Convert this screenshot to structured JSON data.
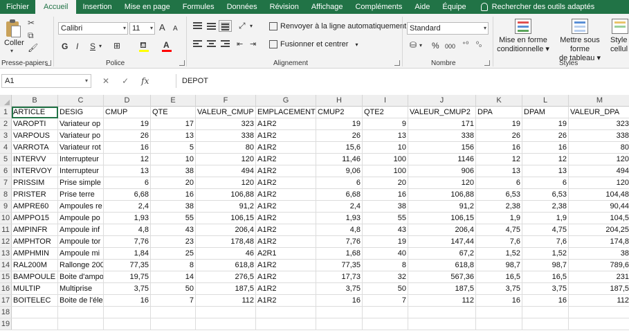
{
  "menu": {
    "tabs": [
      "Fichier",
      "Accueil",
      "Insertion",
      "Mise en page",
      "Formules",
      "Données",
      "Révision",
      "Affichage",
      "Compléments",
      "Aide",
      "Équipe"
    ],
    "active_tab": "Accueil",
    "search": "Rechercher des outils adaptés"
  },
  "ribbon": {
    "clipboard": {
      "paste": "Coller",
      "group": "Presse-papiers"
    },
    "font": {
      "name": "Calibri",
      "size": "11",
      "bold": "G",
      "italic": "I",
      "underline": "S",
      "group": "Police",
      "grow": "A",
      "shrink": "A",
      "text_color": "A",
      "fill_color": "#ffff00",
      "font_color": "#ff0000"
    },
    "alignment": {
      "wrap": "Renvoyer à la ligne automatiquement",
      "merge": "Fusionner et centrer",
      "group": "Alignement"
    },
    "number": {
      "format": "Standard",
      "percent": "%",
      "thousands": "000",
      "group": "Nombre"
    },
    "styles": {
      "conditional_1": "Mise en forme",
      "conditional_2": "conditionnelle",
      "table_1": "Mettre sous forme",
      "table_2": "de tableau",
      "cell_1": "Style",
      "cell_2": "cellul",
      "group": "Styles"
    }
  },
  "formula_bar": {
    "cell_ref": "A1",
    "fx": "fx",
    "content": "DEPOT"
  },
  "sheet": {
    "columns": [
      {
        "letter": "B"
      },
      {
        "letter": "C"
      },
      {
        "letter": "D"
      },
      {
        "letter": "E"
      },
      {
        "letter": "F"
      },
      {
        "letter": "G"
      },
      {
        "letter": "H"
      },
      {
        "letter": "I"
      },
      {
        "letter": "J"
      },
      {
        "letter": "K"
      },
      {
        "letter": "L"
      },
      {
        "letter": "M"
      }
    ],
    "row_numbers": [
      "1",
      "2",
      "3",
      "4",
      "5",
      "6",
      "7",
      "8",
      "9",
      "10",
      "11",
      "12",
      "13",
      "14",
      "15",
      "16",
      "17",
      "18",
      "19"
    ],
    "rows": [
      [
        "ARTICLE",
        "DESIG",
        "CMUP",
        "QTE",
        "VALEUR_CMUP",
        "EMPLACEMENT",
        "CMUP2",
        "QTE2",
        "VALEUR_CMUP2",
        "DPA",
        "DPAM",
        "VALEUR_DPA"
      ],
      [
        "VAROPTI",
        "Variateur op",
        "19",
        "17",
        "323",
        "A1R2",
        "19",
        "9",
        "171",
        "19",
        "19",
        "323"
      ],
      [
        "VARPOUS",
        "Variateur po",
        "26",
        "13",
        "338",
        "A1R2",
        "26",
        "13",
        "338",
        "26",
        "26",
        "338"
      ],
      [
        "VARROTA",
        "Variateur rot",
        "16",
        "5",
        "80",
        "A1R2",
        "15,6",
        "10",
        "156",
        "16",
        "16",
        "80"
      ],
      [
        "INTERVV",
        "Interrupteur",
        "12",
        "10",
        "120",
        "A1R2",
        "11,46",
        "100",
        "1146",
        "12",
        "12",
        "120"
      ],
      [
        "INTERVOY",
        "Interrupteur",
        "13",
        "38",
        "494",
        "A1R2",
        "9,06",
        "100",
        "906",
        "13",
        "13",
        "494"
      ],
      [
        "PRISSIM",
        "Prise simple",
        "6",
        "20",
        "120",
        "A1R2",
        "6",
        "20",
        "120",
        "6",
        "6",
        "120"
      ],
      [
        "PRISTER",
        "Prise terre",
        "6,68",
        "16",
        "106,88",
        "A1R2",
        "6,68",
        "16",
        "106,88",
        "6,53",
        "6,53",
        "104,48"
      ],
      [
        "AMPRE60",
        "Ampoules re",
        "2,4",
        "38",
        "91,2",
        "A1R2",
        "2,4",
        "38",
        "91,2",
        "2,38",
        "2,38",
        "90,44"
      ],
      [
        "AMPPO15",
        "Ampoule po",
        "1,93",
        "55",
        "106,15",
        "A1R2",
        "1,93",
        "55",
        "106,15",
        "1,9",
        "1,9",
        "104,5"
      ],
      [
        "AMPINFR",
        "Ampoule inf",
        "4,8",
        "43",
        "206,4",
        "A1R2",
        "4,8",
        "43",
        "206,4",
        "4,75",
        "4,75",
        "204,25"
      ],
      [
        "AMPHTOR",
        "Ampoule tor",
        "7,76",
        "23",
        "178,48",
        "A1R2",
        "7,76",
        "19",
        "147,44",
        "7,6",
        "7,6",
        "174,8"
      ],
      [
        "AMPHMIN",
        "Ampoule mi",
        "1,84",
        "25",
        "46",
        "A2R1",
        "1,68",
        "40",
        "67,2",
        "1,52",
        "1,52",
        "38"
      ],
      [
        "RAL200M",
        "Rallonge 200",
        "77,35",
        "8",
        "618,8",
        "A1R2",
        "77,35",
        "8",
        "618,8",
        "98,7",
        "98,7",
        "789,6"
      ],
      [
        "BAMPOULE",
        "Boite d'ampo",
        "19,75",
        "14",
        "276,5",
        "A1R2",
        "17,73",
        "32",
        "567,36",
        "16,5",
        "16,5",
        "231"
      ],
      [
        "MULTIP",
        "Multiprise",
        "3,75",
        "50",
        "187,5",
        "A1R2",
        "3,75",
        "50",
        "187,5",
        "3,75",
        "3,75",
        "187,5"
      ],
      [
        "BOITELEC",
        "Boite de l'éle",
        "16",
        "7",
        "112",
        "A1R2",
        "16",
        "7",
        "112",
        "16",
        "16",
        "112"
      ],
      [
        "",
        "",
        "",
        "",
        "",
        "",
        "",
        "",
        "",
        "",
        "",
        ""
      ],
      [
        "",
        "",
        "",
        "",
        "",
        "",
        "",
        "",
        "",
        "",
        "",
        ""
      ]
    ]
  }
}
